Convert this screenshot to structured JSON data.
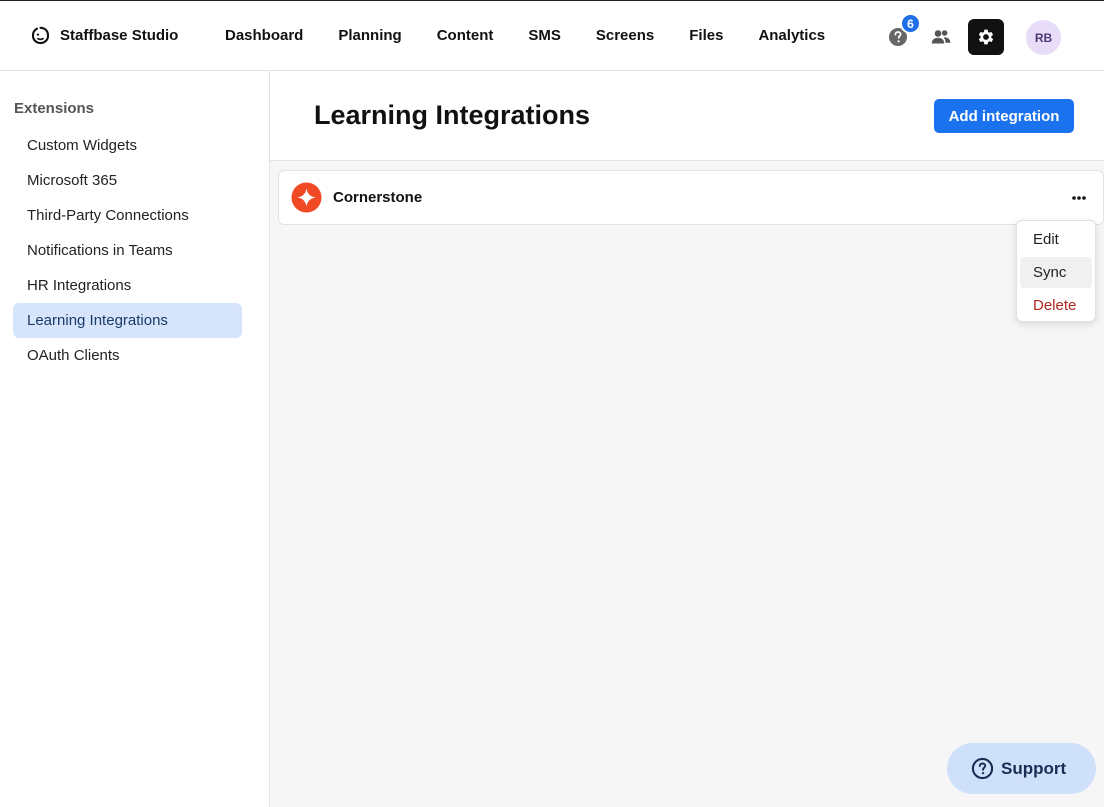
{
  "app": {
    "name": "Staffbase Studio",
    "logo_icon": "staffbase-logo-icon"
  },
  "nav": {
    "items": [
      {
        "label": "Dashboard"
      },
      {
        "label": "Planning"
      },
      {
        "label": "Content"
      },
      {
        "label": "SMS"
      },
      {
        "label": "Screens"
      },
      {
        "label": "Files"
      },
      {
        "label": "Analytics"
      }
    ]
  },
  "header_actions": {
    "help_icon": "help-circle-icon",
    "help_badge": "6",
    "people_icon": "people-icon",
    "settings_icon": "gear-icon",
    "avatar_initials": "RB"
  },
  "sidebar": {
    "heading": "Extensions",
    "items": [
      {
        "label": "Custom Widgets",
        "active": false
      },
      {
        "label": "Microsoft 365",
        "active": false
      },
      {
        "label": "Third-Party Connections",
        "active": false
      },
      {
        "label": "Notifications in Teams",
        "active": false
      },
      {
        "label": "HR Integrations",
        "active": false
      },
      {
        "label": "Learning Integrations",
        "active": true
      },
      {
        "label": "OAuth Clients",
        "active": false
      }
    ]
  },
  "main": {
    "title": "Learning Integrations",
    "add_button_label": "Add integration",
    "integrations": [
      {
        "name": "Cornerstone",
        "icon": "cornerstone-logo-icon"
      }
    ],
    "context_menu": {
      "items": [
        {
          "label": "Edit"
        },
        {
          "label": "Sync"
        },
        {
          "label": "Delete"
        }
      ]
    }
  },
  "support": {
    "label": "Support",
    "icon": "question-circle-icon"
  },
  "colors": {
    "accent": "#1b72ee",
    "active_nav_bg": "#d6e5fb",
    "danger": "#b3261e",
    "cornerstone": "#f04a25"
  }
}
